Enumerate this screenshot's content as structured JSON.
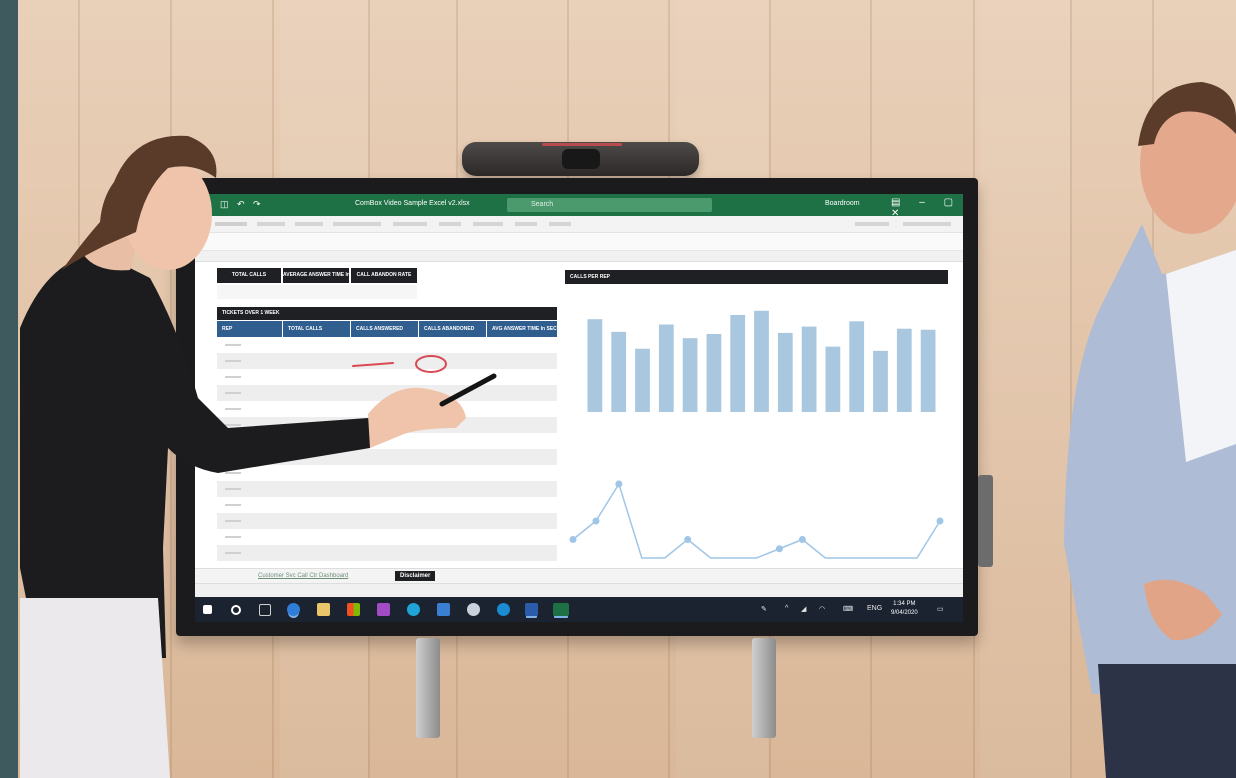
{
  "excel": {
    "window_title": "ComBox Video Sample Excel v2.xlsx",
    "search_placeholder": "Search",
    "user_name": "Boardroom",
    "user_initial": "B",
    "kpis": [
      {
        "label": "TOTAL CALLS"
      },
      {
        "label": "AVERAGE ANSWER TIME In SEC"
      },
      {
        "label": "CALL ABANDON RATE"
      }
    ],
    "table": {
      "title": "TICKETS OVER 1 WEEK",
      "headers": [
        "REP",
        "TOTAL CALLS",
        "CALLS ANSWERED",
        "CALLS ABANDONED",
        "AVG ANSWER TIME In SEC"
      ]
    },
    "chart": {
      "title": "CALLS PER REP"
    },
    "sheet_tabs": {
      "inactive": "Customer Svc Call Ctr Dashboard",
      "active": "Disclaimer"
    },
    "taskbar": {
      "language": "ENG",
      "time": "1:34 PM",
      "date": "9/04/2020"
    }
  },
  "chart_data": {
    "type": "bar",
    "title": "CALLS PER REP",
    "values": [
      88,
      76,
      60,
      83,
      70,
      74,
      92,
      96,
      75,
      81,
      62,
      86,
      58,
      79,
      78
    ],
    "ylim": [
      0,
      110
    ],
    "grid": false,
    "legend": "none"
  },
  "line_chart_data": {
    "type": "line",
    "values": [
      1,
      2,
      4,
      0,
      0,
      1,
      0,
      0,
      0,
      0.5,
      1,
      0,
      0,
      0,
      0,
      0,
      2
    ]
  },
  "colors": {
    "excel_green": "#1e7145",
    "chart_bar": "#a9c7df",
    "line_series": "#9fc6e7",
    "dark_header": "#1f2024",
    "table_header_blue": "#2f5e8f",
    "annotation_red": "#d84a54"
  }
}
